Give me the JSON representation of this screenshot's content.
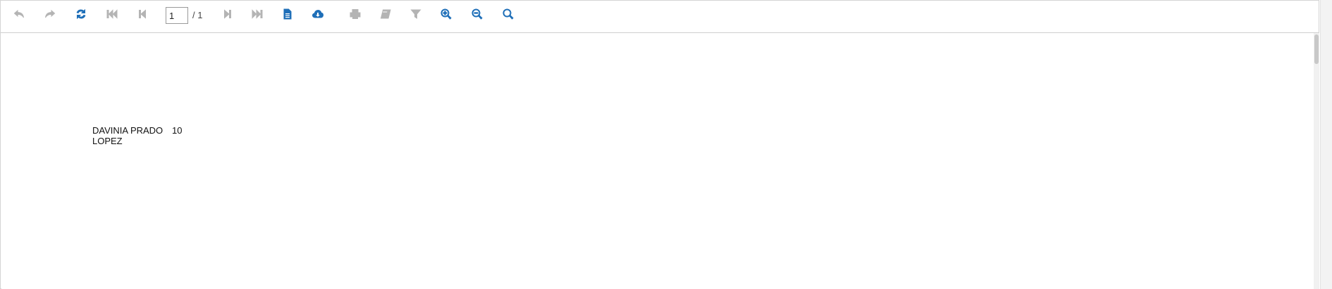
{
  "toolbar": {
    "buttons": [
      {
        "name": "undo-button",
        "icon": "undo-icon",
        "state": "disabled"
      },
      {
        "name": "redo-button",
        "icon": "redo-icon",
        "state": "disabled"
      },
      {
        "name": "refresh-button",
        "icon": "refresh-icon",
        "state": "enabled"
      },
      {
        "name": "first-page-button",
        "icon": "first-page-icon",
        "state": "disabled"
      },
      {
        "name": "previous-page-button",
        "icon": "previous-page-icon",
        "state": "disabled"
      },
      {
        "name": "next-page-button",
        "icon": "next-page-icon",
        "state": "disabled"
      },
      {
        "name": "last-page-button",
        "icon": "last-page-icon",
        "state": "disabled"
      },
      {
        "name": "document-button",
        "icon": "document-icon",
        "state": "enabled"
      },
      {
        "name": "download-button",
        "icon": "cloud-download-icon",
        "state": "enabled"
      },
      {
        "name": "print-button",
        "icon": "print-icon",
        "state": "disabled"
      },
      {
        "name": "bookmarks-button",
        "icon": "book-icon",
        "state": "disabled"
      },
      {
        "name": "filter-button",
        "icon": "filter-icon",
        "state": "disabled"
      },
      {
        "name": "zoom-in-button",
        "icon": "zoom-in-icon",
        "state": "enabled"
      },
      {
        "name": "zoom-out-button",
        "icon": "zoom-out-icon",
        "state": "enabled"
      },
      {
        "name": "search-button",
        "icon": "search-icon",
        "state": "enabled"
      }
    ],
    "page_input_value": "1",
    "page_total": "/ 1"
  },
  "colors": {
    "enabled_icon": "#1f6fb8",
    "disabled_icon": "#b4b4b4"
  },
  "report": {
    "name_line1": "DAVINIA PRADO",
    "name_line2": "LOPEZ",
    "value": "10"
  }
}
